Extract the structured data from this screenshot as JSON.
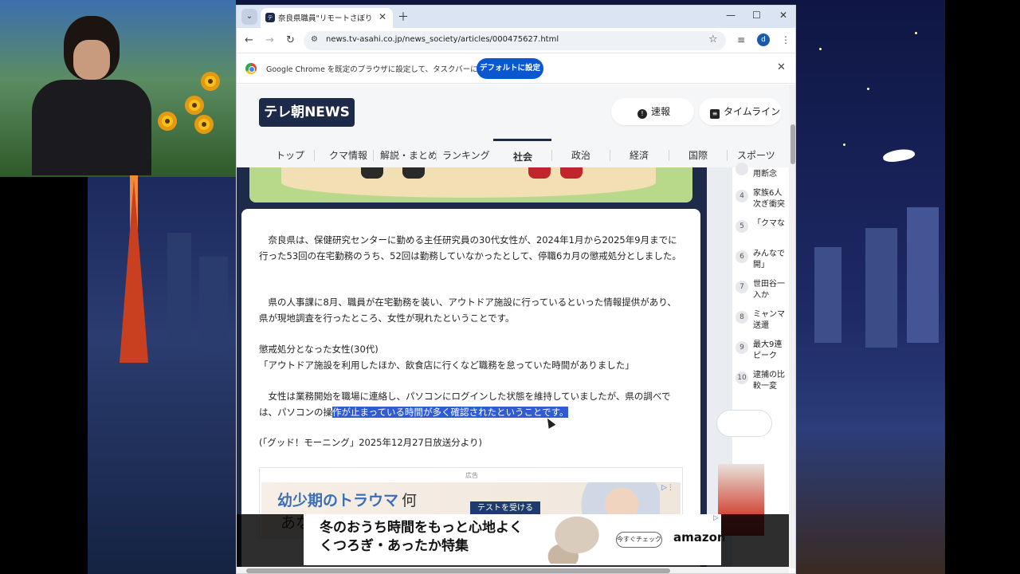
{
  "browser": {
    "tab_title": "奈良県職員\"リモートさぼり\"懲戒処",
    "tab_favicon": "テ",
    "url": "news.tv-asahi.co.jp/news_society/articles/000475627.html",
    "profile_initial": "d"
  },
  "infobar": {
    "text": "Google Chrome を既定のブラウザに設定して、タスクバーに固定する",
    "button": "デフォルトに設定"
  },
  "site": {
    "logo": "テレ朝NEWS",
    "breaking": "速報",
    "timeline": "タイムライン",
    "nav": [
      "トップ",
      "クマ情報",
      "解説・まとめ",
      "ランキング",
      "社会",
      "政治",
      "経済",
      "国際",
      "スポーツ"
    ],
    "active_nav": "社会"
  },
  "article": {
    "p1": "　奈良県は、保健研究センターに勤める主任研究員の30代女性が、2024年1月から2025年9月までに行った53回の在宅勤務のうち、52回は勤務していなかったとして、停職6カ月の懲戒処分としました。",
    "p2": "　県の人事課に8月、職員が在宅勤務を装い、アウトドア施設に行っているといった情報提供があり、県が現地調査を行ったところ、女性が現れたということです。",
    "p3_line1": "懲戒処分となった女性(30代)",
    "p3_line2": "「アウトドア施設を利用したほか、飲食店に行くなど職務を怠っていた時間がありました」",
    "p4_plain": "　女性は業務開始を職場に連絡し、パソコンにログインした状態を維持していましたが、県の調べでは、パソコンの操",
    "p4_highlight": "作が止まっている時間が多く確認されたということです。",
    "p5": "(「グッド！モーニング」2025年12月27日放送分より)"
  },
  "ad": {
    "label": "広告",
    "headline_blue": "幼少期のトラウマ",
    "headline_tail": "何",
    "headline_line2": "あな",
    "cta": "テストを受ける"
  },
  "sidebar": {
    "ranking": [
      {
        "num": "",
        "text": "用断念"
      },
      {
        "num": "4",
        "text": "家族6人"
      },
      {
        "num": "",
        "text": "次ぎ衝突"
      },
      {
        "num": "5",
        "text": "「クマな"
      },
      {
        "num": "6",
        "text": "みんなで"
      },
      {
        "num": "",
        "text": "開」"
      },
      {
        "num": "7",
        "text": "世田谷一"
      },
      {
        "num": "",
        "text": "入か"
      },
      {
        "num": "8",
        "text": "ミャンマ"
      },
      {
        "num": "",
        "text": "送還"
      },
      {
        "num": "9",
        "text": "最大9連"
      },
      {
        "num": "",
        "text": "ピーク"
      },
      {
        "num": "10",
        "text": "逮捕の比"
      },
      {
        "num": "",
        "text": "較一変"
      }
    ]
  },
  "bottom_ad": {
    "line1": "冬のおうち時間をもっと心地よく",
    "line2": "くつろぎ・あったか特集",
    "chip": "今すぐチェック",
    "brand": "amazon"
  }
}
